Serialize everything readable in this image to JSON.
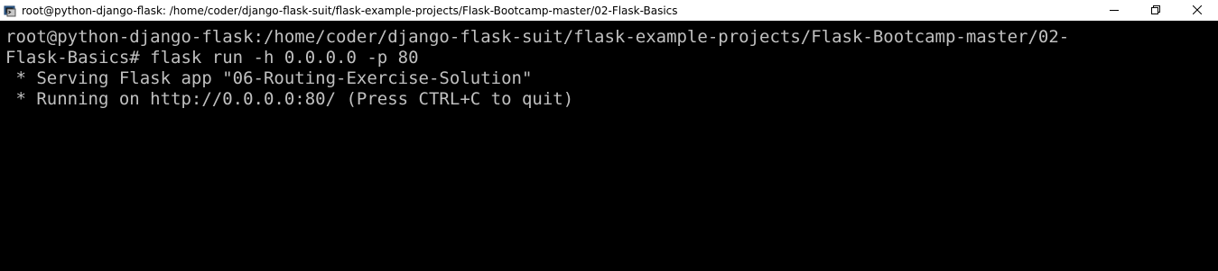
{
  "window": {
    "title": "root@python-django-flask: /home/coder/django-flask-suit/flask-example-projects/Flask-Bootcamp-master/02-Flask-Basics",
    "app_icon": "terminal-icon",
    "controls": [
      "minimize-icon",
      "restore-icon",
      "close-icon"
    ]
  },
  "terminal": {
    "lines": [
      "root@python-django-flask:/home/coder/django-flask-suit/flask-example-projects/Flask-Bootcamp-master/02-",
      "Flask-Basics# flask run -h 0.0.0.0 -p 80",
      " * Serving Flask app \"06-Routing-Exercise-Solution\"",
      " * Running on http://0.0.0.0:80/ (Press CTRL+C to quit)"
    ],
    "text_color": "#c0c0c0",
    "background": "#000000",
    "cursor_color": "#00ff00"
  },
  "titlebar_background": "#ffffff"
}
